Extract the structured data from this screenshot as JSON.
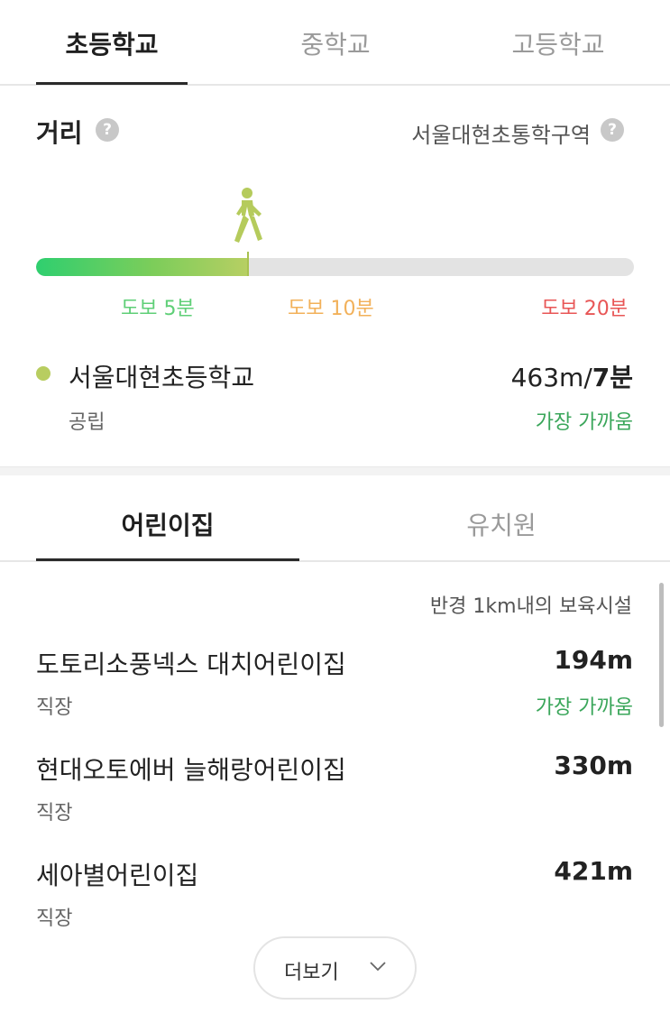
{
  "school_tabs": [
    "초등학교",
    "중학교",
    "고등학교"
  ],
  "distance": {
    "title": "거리",
    "help_glyph": "?",
    "zone": "서울대현초통학구역"
  },
  "walk_bar": {
    "progress_fraction": 0.355,
    "labels": [
      "도보 5분",
      "도보 10분",
      "도보 20분"
    ],
    "colors": {
      "five": "#5fcf77",
      "ten": "#f2b15a",
      "twenty": "#e85656"
    }
  },
  "school": {
    "name": "서울대현초등학교",
    "type": "공립",
    "distance": "463m/",
    "minutes": "7분",
    "badge": "가장 가까움"
  },
  "facility_tabs": [
    "어린이집",
    "유치원"
  ],
  "radius_note": "반경 1km내의 보육시설",
  "facilities": [
    {
      "name": "도토리소풍넥스 대치어린이집",
      "type": "직장",
      "distance": "194m",
      "badge": "가장 가까움"
    },
    {
      "name": "현대오토에버 늘해랑어린이집",
      "type": "직장",
      "distance": "330m"
    },
    {
      "name": "세아별어린이집",
      "type": "직장",
      "distance": "421m"
    }
  ],
  "more_button": {
    "label": "더보기",
    "icon": "chevron-down-icon"
  },
  "accent_colors": {
    "green": "#3aa65a",
    "dot": "#b8cd60"
  }
}
